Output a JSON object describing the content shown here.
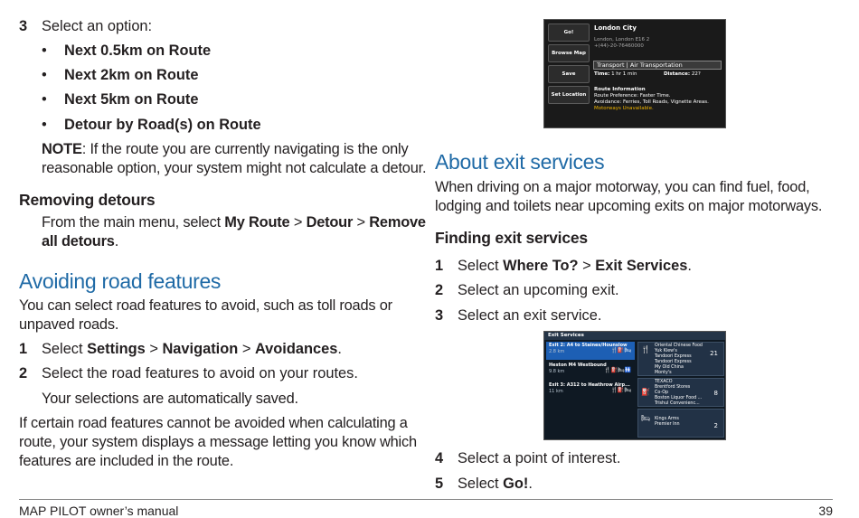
{
  "left": {
    "step3": {
      "num": "3",
      "text": "Select an option:"
    },
    "bullets": [
      "Next 0.5km on Route",
      "Next 2km on Route",
      "Next 5km on Route",
      "Detour by Road(s) on Route"
    ],
    "note": {
      "label": "NOTE",
      "line1": ": If the route you are currently navigating is the only",
      "line2": "reasonable option, your system might not calculate a detour."
    },
    "removing": {
      "heading": "Removing detours",
      "pre": "From the main menu, select ",
      "my_route": "My Route",
      "sep1": " > ",
      "detour": "Detour",
      "sep2": " > ",
      "remove1": "Remove",
      "remove2": "all detours",
      "end": "."
    },
    "avoiding": {
      "heading": "Avoiding road features",
      "intro1": "You can select road features to avoid, such as toll roads or",
      "intro2": "unpaved roads.",
      "step1": {
        "num": "1",
        "pre": "Select ",
        "a": "Settings",
        "sep1": " > ",
        "b": "Navigation",
        "sep2": " > ",
        "c": "Avoidances",
        "end": "."
      },
      "step2": {
        "num": "2",
        "text": "Select the road features to avoid on your routes."
      },
      "saved": "Your selections are automatically saved.",
      "outro1": "If certain road features cannot be avoided when calculating a",
      "outro2": "route, your system displays a message letting you know which",
      "outro3": "features are included in the route."
    }
  },
  "right": {
    "shot1": {
      "buttons": [
        "Go!",
        "Browse Map",
        "Save",
        "Set Location"
      ],
      "name": "London City",
      "address": "London, London E16 2",
      "phone": "+(44)-20-76460000",
      "category": "Transport | Air Transportation",
      "time_label": "Time:",
      "time_value": "1 hr 1 min",
      "distance_label": "Distance:",
      "distance_value": "22?",
      "route_info_title": "Route Information",
      "route_pref": "Route Preference: Faster Time.",
      "avoidance": "Avoidance: Ferries, Toll Roads, Vignette Areas.",
      "unavailable": "Motorways Unavailable."
    },
    "about": {
      "heading": "About exit services",
      "line1": "When driving on a major motorway, you can find fuel, food,",
      "line2": "lodging and toilets near upcoming exits on major motorways."
    },
    "finding": {
      "heading": "Finding exit services",
      "step1": {
        "num": "1",
        "pre": "Select ",
        "a": "Where To?",
        "sep": " > ",
        "b": "Exit Services",
        "end": "."
      },
      "step2": {
        "num": "2",
        "text": "Select an upcoming exit."
      },
      "step3": {
        "num": "3",
        "text": "Select an exit service."
      },
      "step4": {
        "num": "4",
        "text": "Select a point of interest."
      },
      "step5": {
        "num": "5",
        "pre": "Select ",
        "a": "Go!",
        "end": "."
      }
    },
    "shot2": {
      "header": "Exit Services",
      "exits": [
        {
          "name": "Exit 2: A4 to Staines/Hounslow",
          "dist": "2.8 km",
          "icons": "🍴⛽🛏"
        },
        {
          "name": "Heston M4 Westbound",
          "dist": "9.8 km",
          "icons": "🍴⛽🛏🚻"
        },
        {
          "name": "Exit 3: A312 to Heathrow Airp...",
          "dist": "11 km",
          "icons": "🍴⛽🛏"
        }
      ],
      "services": [
        {
          "icon": "🍴",
          "count": "21",
          "items": [
            "Oriental Chinese Food",
            "Yuk Kiew's",
            "Tandoori Express",
            "Tandoori Express",
            "My Old China",
            "Monty's"
          ]
        },
        {
          "icon": "⛽",
          "count": "8",
          "items": [
            "TEXACO",
            "Brentford Stores",
            "Co-Op",
            "Boston Liquor Food ...",
            "Trishul Convenienc..."
          ]
        },
        {
          "icon": "🛏",
          "count": "2",
          "items": [
            "Kings Arms",
            "Premier Inn"
          ]
        }
      ]
    }
  },
  "footer": {
    "left": "MAP PILOT owner’s manual",
    "right": "39"
  },
  "colors": {
    "heading_blue": "#1f6aa6",
    "text": "#231f20",
    "selected_exit": "#1d5fb4"
  }
}
